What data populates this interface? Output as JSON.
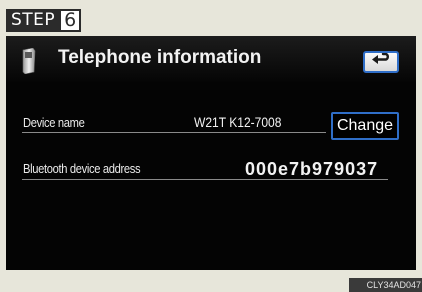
{
  "step": {
    "label": "STEP",
    "number": "6"
  },
  "screen": {
    "title": "Telephone information",
    "icons": {
      "header": "phone-icon",
      "back": "back-arrow-icon"
    },
    "rows": [
      {
        "label": "Device name",
        "value": "W21T  K12-7008",
        "button_label": "Change"
      },
      {
        "label": "Bluetooth device address",
        "value": "000e7b979037"
      }
    ]
  },
  "image_code": "CLY34AD047",
  "colors": {
    "screen_background": "#040404",
    "button_border": "#2f6ec8",
    "text": "#f2f2f2",
    "page_background": "#e7e6da"
  }
}
